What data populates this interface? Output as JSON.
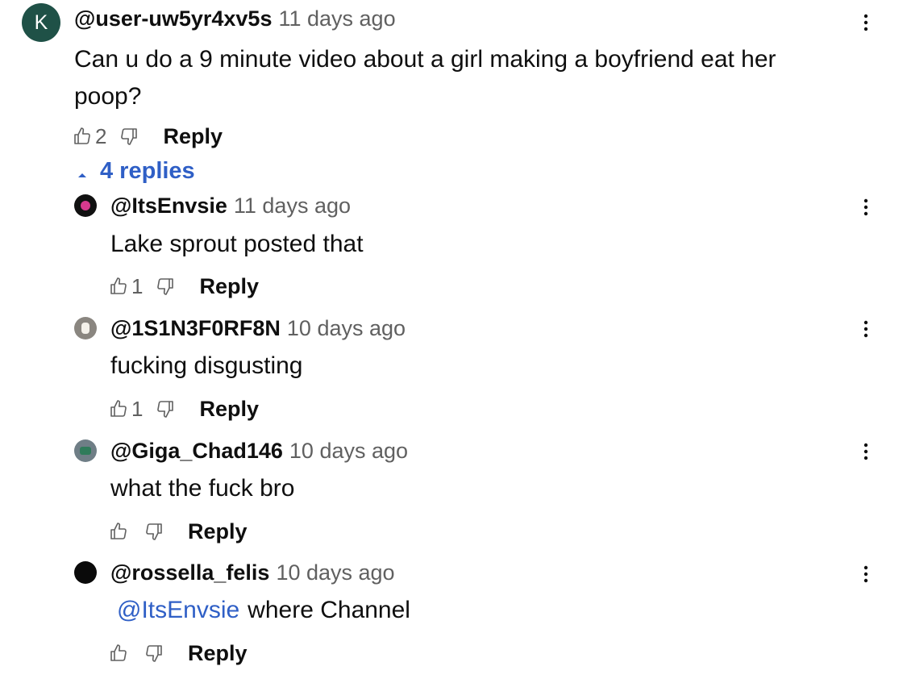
{
  "top_comment": {
    "avatar_letter": "K",
    "handle": "@user-uw5yr4xv5s",
    "time": "11 days ago",
    "text_line1": "Can u do a 9 minute video about a girl making a boyfriend eat her",
    "text_line2": "poop?",
    "likes": "2",
    "reply_label": "Reply",
    "replies_toggle": "4 replies",
    "colors": {
      "avatar_bg": "#1f5147",
      "link": "#2f5fc6"
    }
  },
  "replies": [
    {
      "handle": "@ItsEnvsie",
      "time": "11 days ago",
      "text": "Lake sprout posted that",
      "likes": "1",
      "reply_label": "Reply"
    },
    {
      "handle": "@1S1N3F0RF8N",
      "time": "10 days ago",
      "text": "fucking disgusting",
      "likes": "1",
      "reply_label": "Reply"
    },
    {
      "handle": "@Giga_Chad146",
      "time": "10 days ago",
      "text": "what the fuck bro",
      "likes": "",
      "reply_label": "Reply"
    },
    {
      "handle": "@rossella_felis",
      "time": "10 days ago",
      "mention": "@ItsEnvsie",
      "text": "where Channel",
      "likes": "",
      "reply_label": "Reply"
    }
  ],
  "icons": {
    "like": "thumbs-up-outline-icon",
    "dislike": "thumbs-down-outline-icon",
    "more": "vertical-ellipsis-icon",
    "collapse": "caret-up-icon"
  }
}
